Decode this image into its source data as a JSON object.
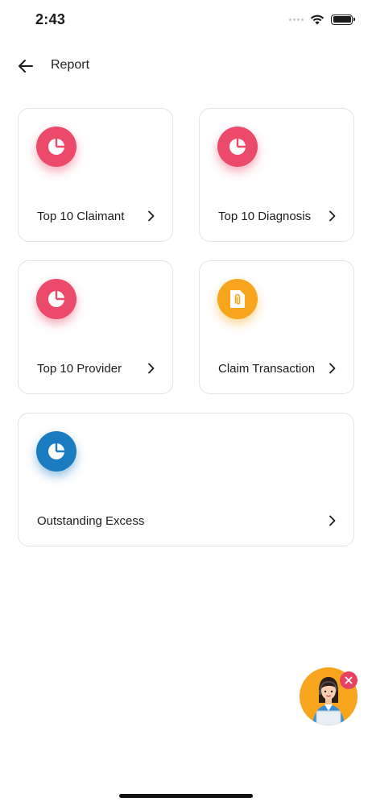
{
  "status_bar": {
    "time": "2:43"
  },
  "header": {
    "title": "Report",
    "back_icon": "arrow-left-icon"
  },
  "cards": [
    {
      "label": "Top 10 Claimant",
      "icon": "pie-chart-icon",
      "color": "#ec4a6a"
    },
    {
      "label": "Top 10 Diagnosis",
      "icon": "pie-chart-icon",
      "color": "#ec4a6a"
    },
    {
      "label": "Top 10 Provider",
      "icon": "pie-chart-icon",
      "color": "#ec4a6a"
    },
    {
      "label": "Claim Transaction",
      "icon": "document-attachment-icon",
      "color": "#f7a51d"
    },
    {
      "label": "Outstanding Excess",
      "icon": "pie-chart-icon",
      "color": "#1a7bc1"
    }
  ],
  "chat_widget": {
    "icon": "support-agent-icon",
    "close_icon": "close-icon",
    "color": "#f7a51d"
  }
}
